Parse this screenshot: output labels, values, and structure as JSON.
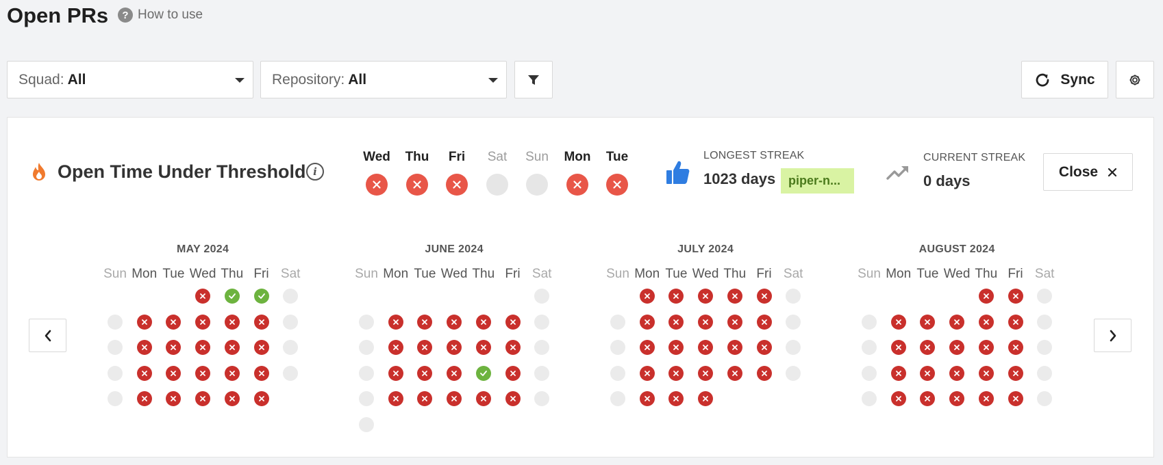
{
  "header": {
    "title": "Open PRs",
    "how_to_use": "How to use",
    "help_icon": "question-circle-icon"
  },
  "filters": {
    "squad": {
      "label": "Squad:",
      "value": "All"
    },
    "repository": {
      "label": "Repository:",
      "value": "All"
    },
    "filter_icon": "funnel-icon"
  },
  "toolbar": {
    "sync_label": "Sync",
    "settings_icon": "gear-icon"
  },
  "panel": {
    "title": "Open Time Under Threshold",
    "week": [
      {
        "day": "Wed",
        "status": "fail",
        "weekend": false
      },
      {
        "day": "Thu",
        "status": "fail",
        "weekend": false
      },
      {
        "day": "Fri",
        "status": "fail",
        "weekend": false
      },
      {
        "day": "Sat",
        "status": "none",
        "weekend": true
      },
      {
        "day": "Sun",
        "status": "none",
        "weekend": true
      },
      {
        "day": "Mon",
        "status": "fail",
        "weekend": false
      },
      {
        "day": "Tue",
        "status": "fail",
        "weekend": false
      }
    ],
    "longest_streak": {
      "label": "LONGEST STREAK",
      "value": "1023 days",
      "repo": "piper-n..."
    },
    "current_streak": {
      "label": "CURRENT STREAK",
      "value": "0 days"
    },
    "close_label": "Close"
  },
  "calendar": {
    "day_headers": [
      "Sun",
      "Mon",
      "Tue",
      "Wed",
      "Thu",
      "Fri",
      "Sat"
    ],
    "months": [
      {
        "title": "MAY 2024",
        "weeks": [
          [
            "",
            "",
            "",
            "x",
            "v",
            "v",
            "o"
          ],
          [
            "o",
            "x",
            "x",
            "x",
            "x",
            "x",
            "o"
          ],
          [
            "o",
            "x",
            "x",
            "x",
            "x",
            "x",
            "o"
          ],
          [
            "o",
            "x",
            "x",
            "x",
            "x",
            "x",
            "o"
          ],
          [
            "o",
            "x",
            "x",
            "x",
            "x",
            "x",
            ""
          ]
        ]
      },
      {
        "title": "JUNE 2024",
        "weeks": [
          [
            "",
            "",
            "",
            "",
            "",
            "",
            "o"
          ],
          [
            "o",
            "x",
            "x",
            "x",
            "x",
            "x",
            "o"
          ],
          [
            "o",
            "x",
            "x",
            "x",
            "x",
            "x",
            "o"
          ],
          [
            "o",
            "x",
            "x",
            "x",
            "v",
            "x",
            "o"
          ],
          [
            "o",
            "x",
            "x",
            "x",
            "x",
            "x",
            "o"
          ],
          [
            "o",
            "",
            "",
            "",
            "",
            "",
            ""
          ]
        ]
      },
      {
        "title": "JULY 2024",
        "weeks": [
          [
            "",
            "x",
            "x",
            "x",
            "x",
            "x",
            "o"
          ],
          [
            "o",
            "x",
            "x",
            "x",
            "x",
            "x",
            "o"
          ],
          [
            "o",
            "x",
            "x",
            "x",
            "x",
            "x",
            "o"
          ],
          [
            "o",
            "x",
            "x",
            "x",
            "x",
            "x",
            "o"
          ],
          [
            "o",
            "x",
            "x",
            "x",
            "",
            "",
            ""
          ]
        ]
      },
      {
        "title": "AUGUST 2024",
        "weeks": [
          [
            "",
            "",
            "",
            "",
            "x",
            "x",
            "o"
          ],
          [
            "o",
            "x",
            "x",
            "x",
            "x",
            "x",
            "o"
          ],
          [
            "o",
            "x",
            "x",
            "x",
            "x",
            "x",
            "o"
          ],
          [
            "o",
            "x",
            "x",
            "x",
            "x",
            "x",
            "o"
          ],
          [
            "o",
            "x",
            "x",
            "x",
            "x",
            "x",
            "o"
          ]
        ]
      }
    ]
  },
  "colors": {
    "fail": "#c9302c",
    "pass": "#6db33f",
    "none": "#ebebeb",
    "accent_blue": "#2f7de1",
    "flame": "#f07a2e"
  }
}
